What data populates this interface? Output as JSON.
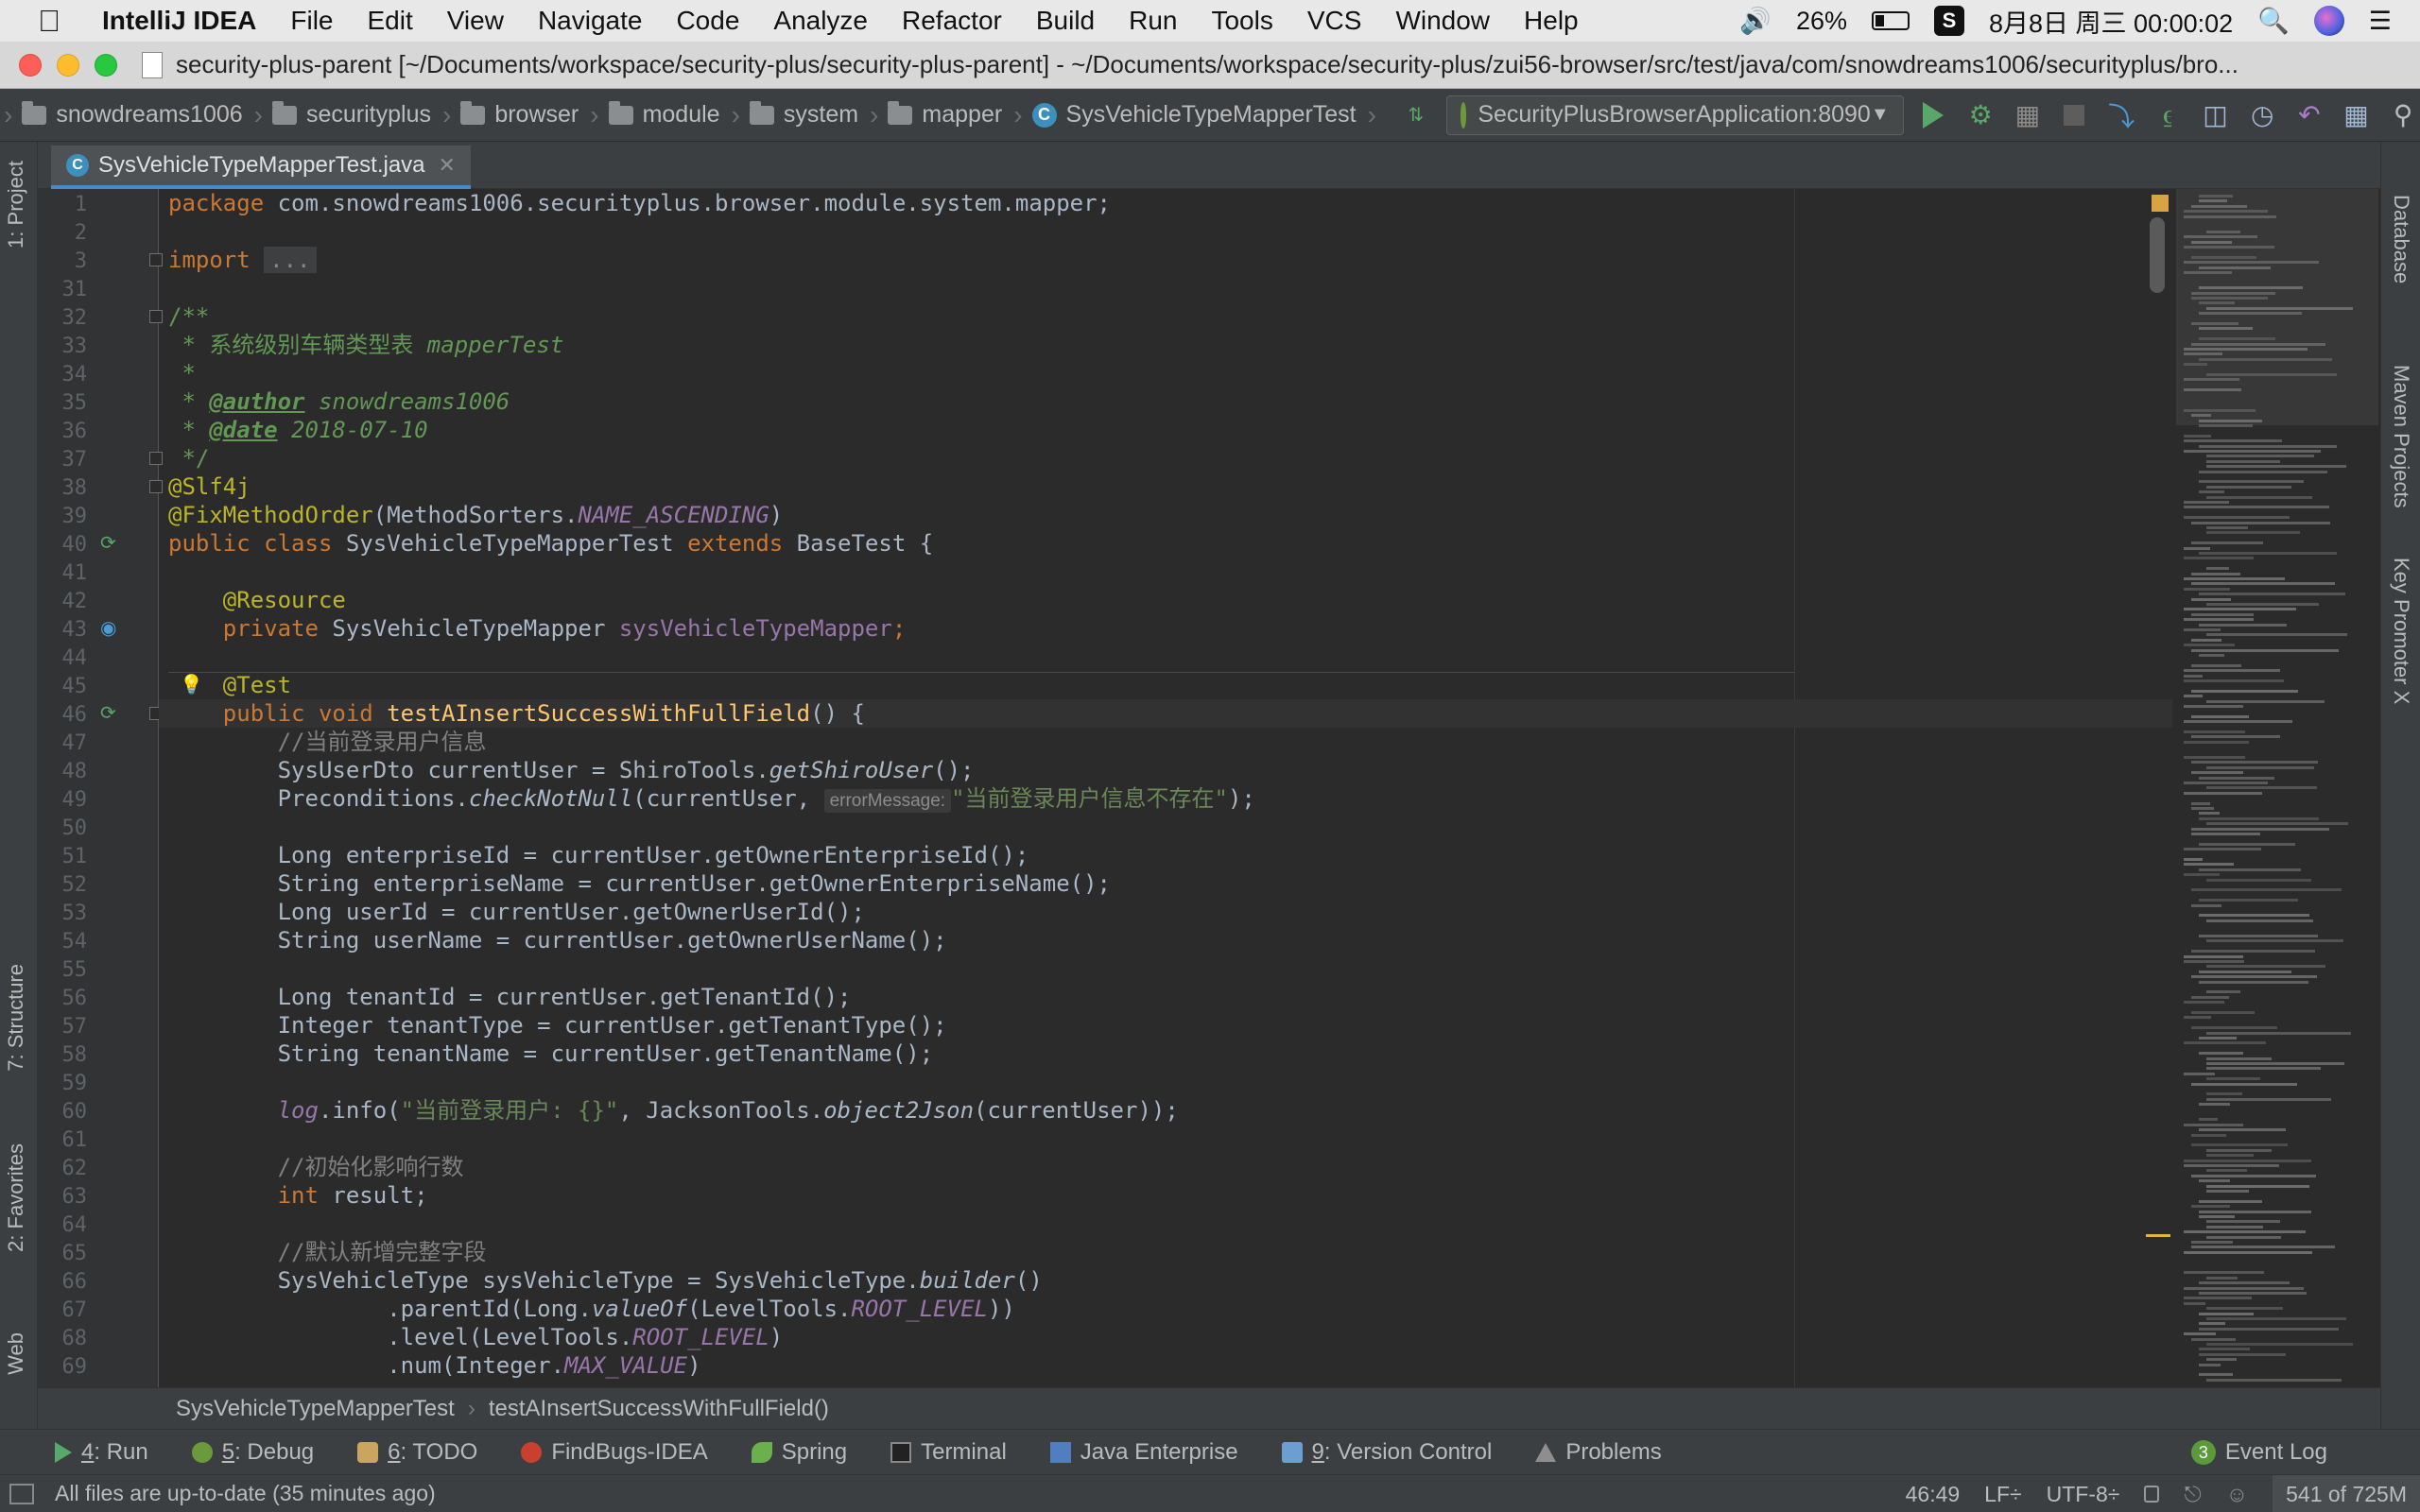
{
  "menubar": {
    "app": "IntelliJ IDEA",
    "items": [
      "File",
      "Edit",
      "View",
      "Navigate",
      "Code",
      "Analyze",
      "Refactor",
      "Build",
      "Run",
      "Tools",
      "VCS",
      "Window",
      "Help"
    ],
    "battery": "26%",
    "battery_level": 0.26,
    "datetime": "8月8日 周三  00:00:02",
    "icons": [
      "apple-icon",
      "volume-icon",
      "battery-icon",
      "sogou-icon",
      "search-icon",
      "siri-icon",
      "list-icon"
    ]
  },
  "window": {
    "title": "security-plus-parent [~/Documents/workspace/security-plus/security-plus-parent] - ~/Documents/workspace/security-plus/zui56-browser/src/test/java/com/snowdreams1006/securityplus/bro..."
  },
  "navbar": {
    "crumbs": [
      "snowdreams1006",
      "securityplus",
      "browser",
      "module",
      "system",
      "mapper"
    ],
    "current_class": "SysVehicleTypeMapperTest",
    "run_config": "SecurityPlusBrowserApplication:8090"
  },
  "left_tools": {
    "project": "1: Project",
    "structure": "7: Structure",
    "favorites": "2: Favorites",
    "web": "Web"
  },
  "right_tools": {
    "database": "Database",
    "maven": "Maven Projects",
    "key_promoter": "Key Promoter X"
  },
  "editor": {
    "tab": "SysVehicleTypeMapperTest.java",
    "line_numbers": [
      "1",
      "2",
      "3",
      "31",
      "32",
      "33",
      "34",
      "35",
      "36",
      "37",
      "38",
      "39",
      "40",
      "41",
      "42",
      "43",
      "44",
      "45",
      "46",
      "47",
      "48",
      "49",
      "50",
      "51",
      "52",
      "53",
      "54",
      "55",
      "56",
      "57",
      "58",
      "59",
      "60",
      "61",
      "62",
      "63",
      "64",
      "65",
      "66",
      "67",
      "68",
      "69"
    ],
    "code": {
      "l1_kw": "package",
      "l1_rest": " com.snowdreams1006.securityplus.browser.module.system.mapper;",
      "l3_kw": "import",
      "l3_fold": "...",
      "l32": "/**",
      "l33_a": " * 系统级别车辆类型表 ",
      "l33_b": "mapperTest",
      "l34": " *",
      "l35_a": " * ",
      "l35_tag": "@author",
      "l35_b": " snowdreams1006",
      "l36_a": " * ",
      "l36_tag": "@date",
      "l36_b": " 2018-07-10",
      "l37": " */",
      "l38": "@Slf4j",
      "l39_ann": "@FixMethodOrder",
      "l39_a": "(MethodSorters.",
      "l39_static": "NAME_ASCENDING",
      "l39_b": ")",
      "l40_kw1": "public class",
      "l40_a": " SysVehicleTypeMapperTest ",
      "l40_kw2": "extends",
      "l40_b": " BaseTest {",
      "l42": "    @Resource",
      "l43_kw": "    private",
      "l43_a": " SysVehicleTypeMapper ",
      "l43_field": "sysVehicleTypeMapper",
      "l43_b": ";",
      "l45": "    @Test",
      "l46_kw": "    public void",
      "l46_meth": " testAInsertSuccessWithFullField",
      "l46_b": "() {",
      "l47": "        //当前登录用户信息",
      "l48_a": "        SysUserDto currentUser = ShiroTools.",
      "l48_sm": "getShiroUser",
      "l48_b": "();",
      "l49_a": "        Preconditions.",
      "l49_sm": "checkNotNull",
      "l49_b": "(currentUser, ",
      "l49_hint": "errorMessage:",
      "l49_str": "\"当前登录用户信息不存在\"",
      "l49_c": ");",
      "l51": "        Long enterpriseId = currentUser.getOwnerEnterpriseId();",
      "l52": "        String enterpriseName = currentUser.getOwnerEnterpriseName();",
      "l53": "        Long userId = currentUser.getOwnerUserId();",
      "l54": "        String userName = currentUser.getOwnerUserName();",
      "l56": "        Long tenantId = currentUser.getTenantId();",
      "l57": "        Integer tenantType = currentUser.getTenantType();",
      "l58": "        String tenantName = currentUser.getTenantName();",
      "l60_pre": "        ",
      "l60_field": "log",
      "l60_a": ".info(",
      "l60_str": "\"当前登录用户: {}\"",
      "l60_b": ", JacksonTools.",
      "l60_sm": "object2Json",
      "l60_c": "(currentUser));",
      "l62": "        //初始化影响行数",
      "l63_kw": "        int",
      "l63_b": " result;",
      "l65": "        //默认新增完整字段",
      "l66_a": "        SysVehicleType sysVehicleType = SysVehicleType.",
      "l66_sm": "builder",
      "l66_b": "()",
      "l67_a": "                .parentId(Long.",
      "l67_sm": "valueOf",
      "l67_b": "(LevelTools.",
      "l67_static": "ROOT_LEVEL",
      "l67_c": "))",
      "l68_a": "                .level(LevelTools.",
      "l68_static": "ROOT_LEVEL",
      "l68_b": ")",
      "l69_a": "                .num(Integer.",
      "l69_static": "MAX_VALUE",
      "l69_b": ")"
    }
  },
  "editor_breadcrumb": {
    "class": "SysVehicleTypeMapperTest",
    "method": "testAInsertSuccessWithFullField()"
  },
  "bottom_tools": {
    "run_num": "4",
    "run": ": Run",
    "debug_num": "5",
    "debug": ": Debug",
    "todo_num": "6",
    "todo": ": TODO",
    "findbugs": "FindBugs-IDEA",
    "spring": "Spring",
    "terminal": "Terminal",
    "java_enterprise": "Java Enterprise",
    "vcs_num": "9",
    "vcs": ": Version Control",
    "problems": "Problems",
    "event_count": "3",
    "event_log": "Event Log"
  },
  "statusbar": {
    "message": "All files are up-to-date (35 minutes ago)",
    "position": "46:49",
    "line_sep": "LF÷",
    "encoding": "UTF-8÷",
    "memory": "541 of 725M"
  }
}
